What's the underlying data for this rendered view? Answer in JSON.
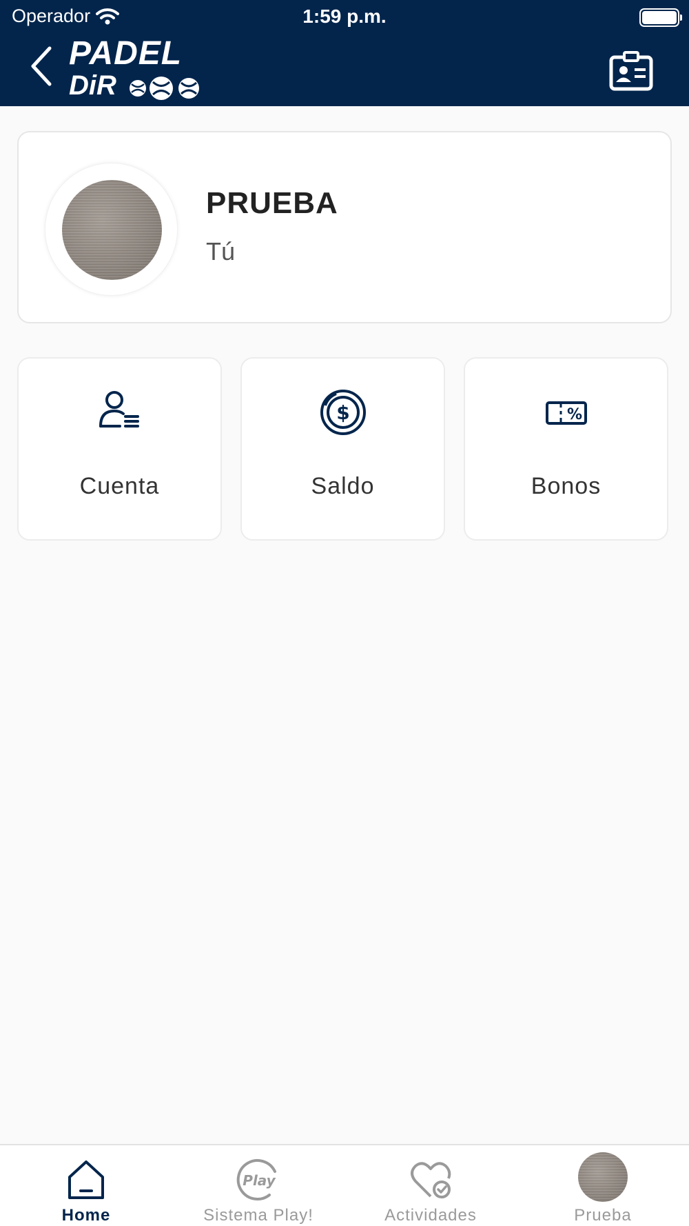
{
  "status_bar": {
    "carrier": "Operador",
    "time": "1:59 p.m."
  },
  "header": {
    "logo_line1": "PADEL",
    "logo_line2": "DiR",
    "back_icon": "chevron-left-icon",
    "card_icon": "id-card-icon"
  },
  "profile": {
    "name": "PRUEBA",
    "subtitle": "Tú"
  },
  "tiles": [
    {
      "label": "Cuenta",
      "icon": "user-list-icon"
    },
    {
      "label": "Saldo",
      "icon": "dollar-coin-icon"
    },
    {
      "label": "Bonos",
      "icon": "percent-ticket-icon"
    }
  ],
  "tabbar": {
    "items": [
      {
        "label": "Home",
        "icon": "home-icon",
        "active": true
      },
      {
        "label": "Sistema Play!",
        "icon": "play-icon",
        "active": false
      },
      {
        "label": "Actividades",
        "icon": "heart-check-icon",
        "active": false
      },
      {
        "label": "Prueba",
        "icon": "avatar",
        "active": false
      }
    ]
  },
  "colors": {
    "brand_navy": "#03254c",
    "background": "#fafafa",
    "inactive_tab": "#9a9a9a"
  }
}
